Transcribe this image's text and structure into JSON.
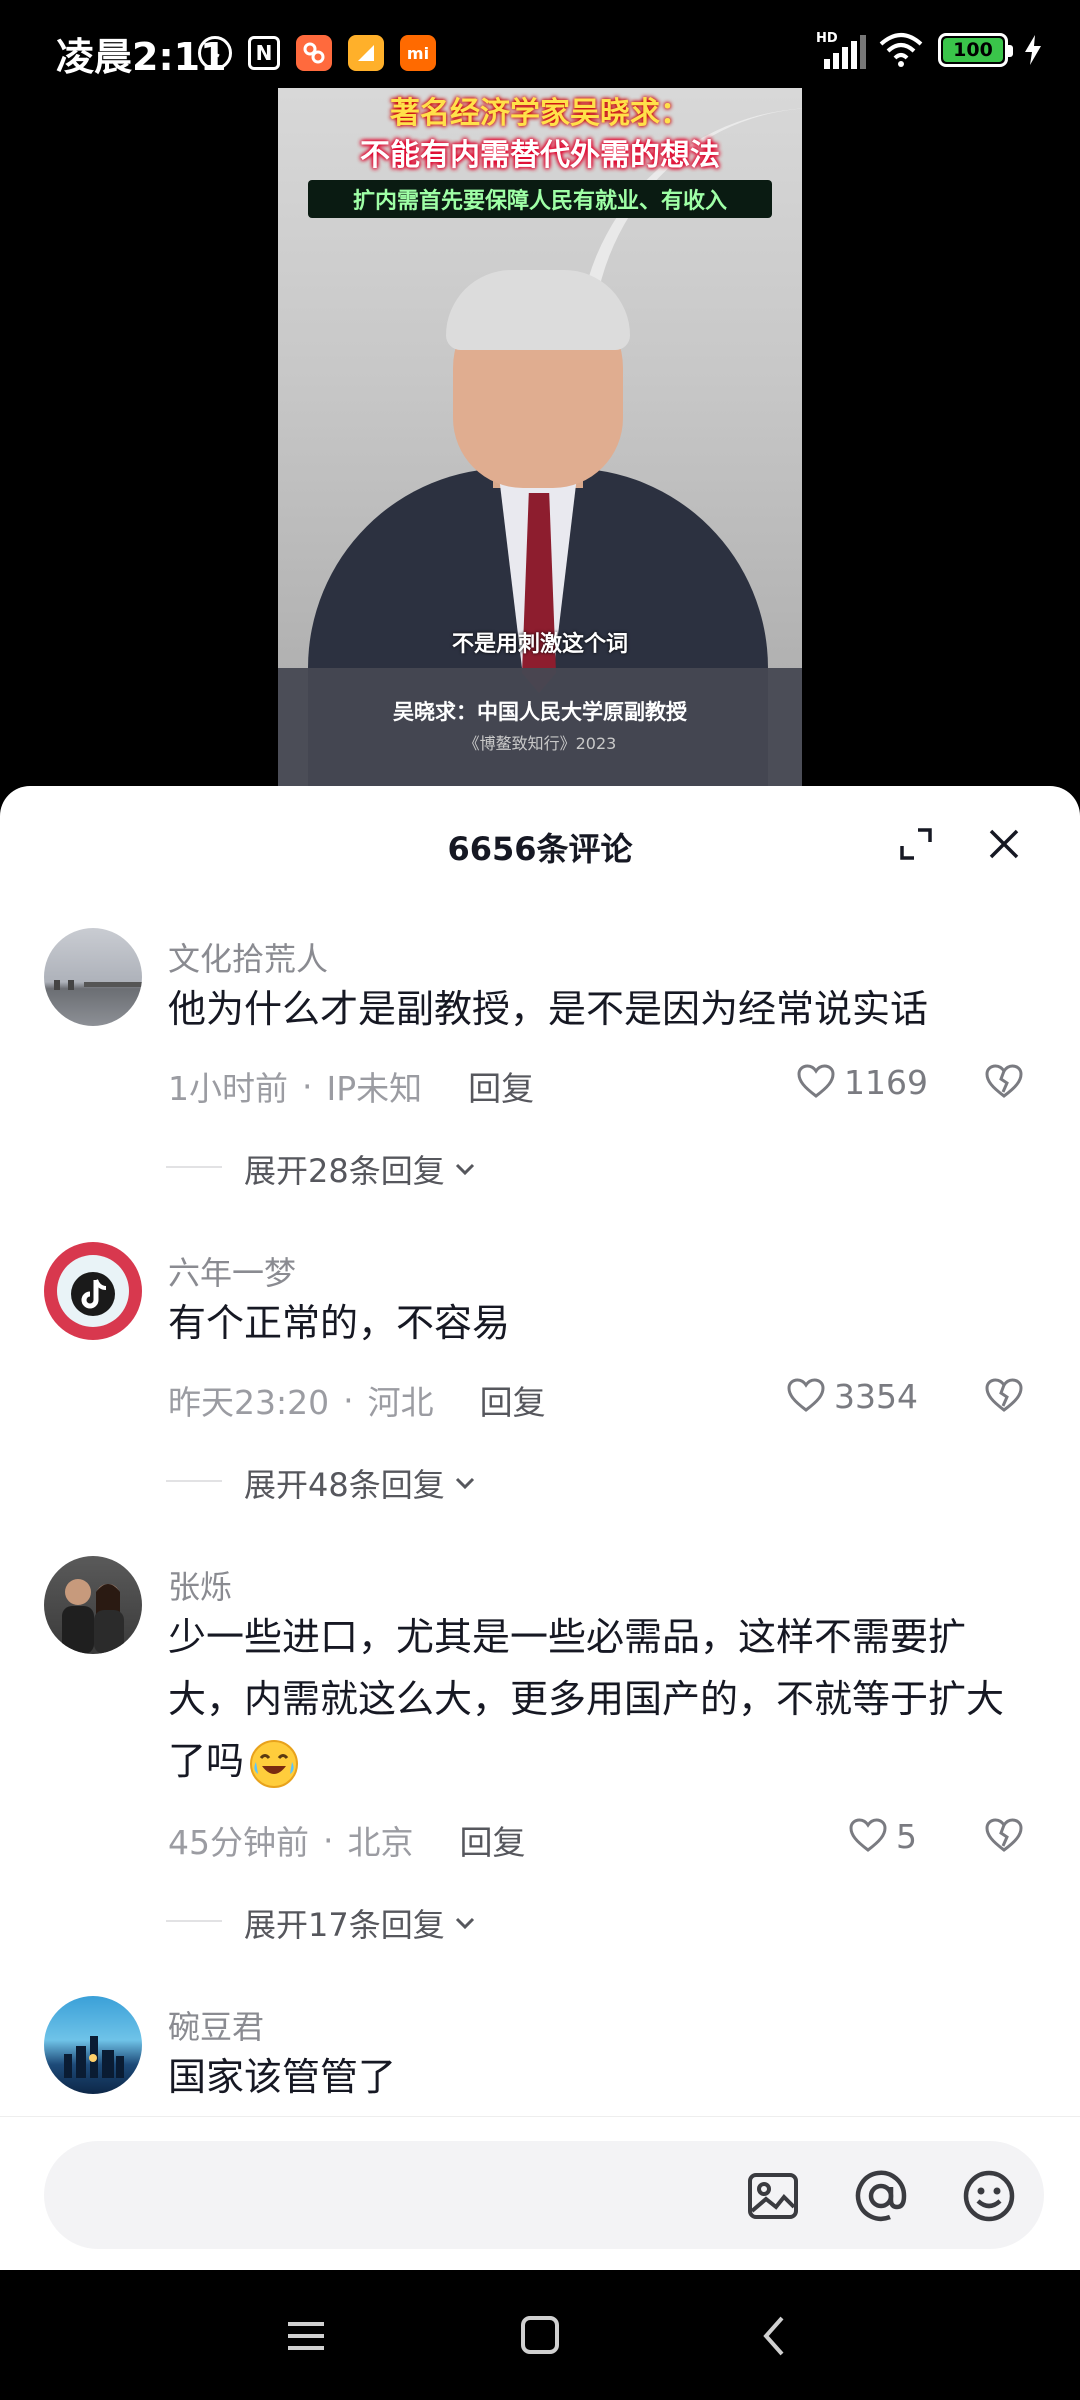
{
  "status_bar": {
    "time": "凌晨2:11",
    "battery": "100",
    "network_label": "HD",
    "app_icons": [
      "alarm-icon",
      "nfc-icon",
      "app-icon-orange",
      "app-icon-yellow",
      "mi-icon"
    ],
    "nfc_glyph": "N",
    "mi_glyph": "mi"
  },
  "video": {
    "title_line1": "著名经济学家吴晓求：",
    "title_line2": "不能有内需替代外需的想法",
    "title_line3": "扩内需首先要保障人民有就业、有收入",
    "subtitle": "不是用刺激这个词",
    "footer_name": "吴晓求：中国人民大学原副教授",
    "footer_source": "《博鳌致知行》2023"
  },
  "comments_sheet": {
    "title": "6656条评论",
    "reply_label": "回复",
    "comments": [
      {
        "username": "文化拾荒人",
        "text": "他为什么才是副教授，是不是因为经常说实话",
        "time": "1小时前",
        "location": "IP未知",
        "likes": "1169",
        "expand_label": "展开28条回复"
      },
      {
        "username": "六年一梦",
        "text": "有个正常的，不容易",
        "time": "昨天23:20",
        "location": "河北",
        "likes": "3354",
        "expand_label": "展开48条回复"
      },
      {
        "username": "张烁",
        "text": "少一些进口，尤其是一些必需品，这样不需要扩大，内需就这么大，更多用国产的，不就等于扩大了吗",
        "time": "45分钟前",
        "location": "北京",
        "likes": "5",
        "expand_label": "展开17条回复"
      },
      {
        "username": "碗豆君",
        "text": "国家该管管了"
      }
    ]
  },
  "input_bar": {
    "placeholder": ""
  },
  "colors": {
    "battery_green": "#3ac44a",
    "text_primary": "#161823",
    "text_secondary": "#8a8b91"
  }
}
